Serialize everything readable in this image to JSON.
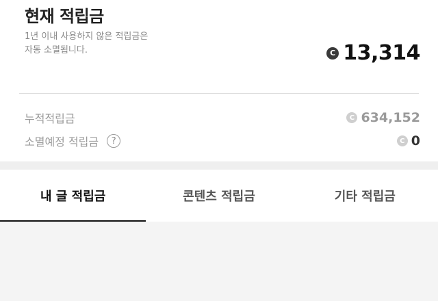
{
  "header": {
    "title": "현재 적립금",
    "note_line1": "1년 이내 사용하지 않은 적립금은",
    "note_line2": "자동 소멸됩니다.",
    "balance": "13,314",
    "coin_icon": "C"
  },
  "summary": {
    "accumulated_label": "누적적립금",
    "accumulated_value": "634,152",
    "expiring_label": "소멸예정 적립금",
    "expiring_value": "0",
    "help_icon": "?"
  },
  "tabs": [
    {
      "label": "내 글 적립금",
      "active": true
    },
    {
      "label": "콘텐츠 적립금",
      "active": false
    },
    {
      "label": "기타 적립금",
      "active": false
    }
  ]
}
